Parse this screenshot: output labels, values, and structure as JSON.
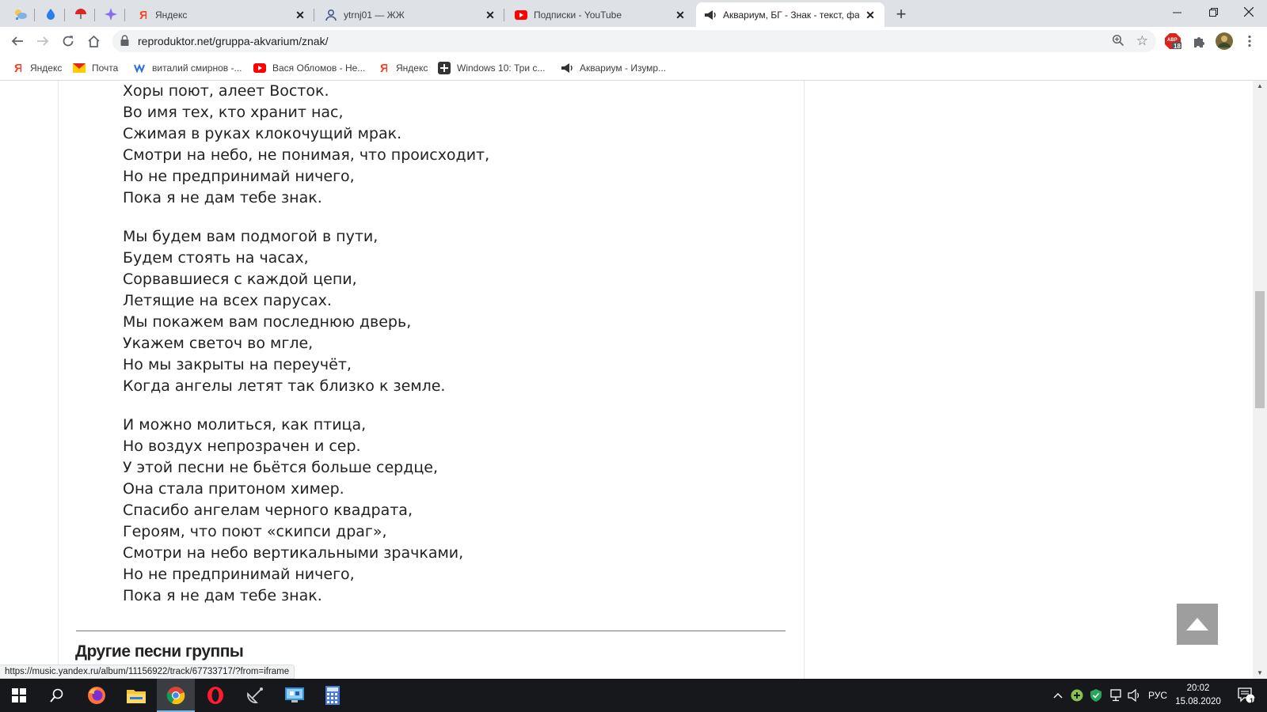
{
  "browser": {
    "pinned_tabs": [
      {
        "icon": "weather-icon"
      },
      {
        "icon": "drop-icon"
      },
      {
        "icon": "umbrella-icon"
      },
      {
        "icon": "sparkle-icon"
      }
    ],
    "tabs": [
      {
        "title": "Яндекс",
        "icon": "yandex-icon",
        "active": false
      },
      {
        "title": "ytrnj01 — ЖЖ",
        "icon": "user-icon",
        "active": false
      },
      {
        "title": "Подписки - YouTube",
        "icon": "youtube-icon",
        "active": false
      },
      {
        "title": "Аквариум, БГ - Знак - текст, фа",
        "icon": "speaker-icon",
        "active": true
      }
    ],
    "url": "reproduktor.net/gruppa-akvarium/znak/",
    "extension_badge": "18",
    "bookmarks": [
      {
        "label": "Яндекс",
        "icon": "yandex-icon"
      },
      {
        "label": "Почта",
        "icon": "mail-icon"
      },
      {
        "label": "виталий смирнов -...",
        "icon": "vk-icon"
      },
      {
        "label": "Вася Обломов - Не...",
        "icon": "youtube-icon"
      },
      {
        "label": "Яндекс",
        "icon": "yandex-icon"
      },
      {
        "label": "Windows 10: Три с...",
        "icon": "plus-square-icon"
      },
      {
        "label": "Аквариум - Изумр...",
        "icon": "speaker-icon"
      }
    ]
  },
  "page": {
    "stanzas": [
      {
        "lines": [
          "Хоры поют, алеет Восток.",
          "Во имя тех, кто хранит нас,",
          "Сжимая в руках клокочущий мрак.",
          "Смотри на небо, не понимая, что происходит,",
          "Но не предпринимай ничего,",
          "Пока я не дам тебе знак."
        ]
      },
      {
        "lines": [
          "Мы будем вам подмогой в пути,",
          "Будем стоять на часах,",
          "Сорвавшиеся с каждой цепи,",
          "Летящие на всех парусах.",
          "Мы покажем вам последнюю дверь,",
          "Укажем светоч во мгле,",
          "Но мы закрыты на переучёт,",
          "Когда ангелы летят так близко к земле."
        ]
      },
      {
        "lines": [
          "И можно молиться, как птица,",
          "Но воздух непрозрачен и сер.",
          "У этой песни не бьётся больше сердце,",
          "Она стала притоном химер.",
          "Спасибо ангелам черного квадрата,",
          "Героям, что поют «скипси драг»,",
          "Смотри на небо вертикальными зрачками,",
          "Но не предпринимай ничего,",
          "Пока я не дам тебе знак."
        ]
      }
    ],
    "section_title": "Другие песни группы",
    "status_url": "https://music.yandex.ru/album/11156922/track/67733717/?from=iframe"
  },
  "taskbar": {
    "apps": [
      "windows-start-icon",
      "search-icon",
      "firefox-icon",
      "file-explorer-icon",
      "chrome-icon",
      "opera-icon",
      "satellite-icon",
      "control-panel-icon",
      "calculator-icon"
    ],
    "language": "РУС",
    "time": "20:02",
    "date": "15.08.2020",
    "notification_count": "15"
  }
}
